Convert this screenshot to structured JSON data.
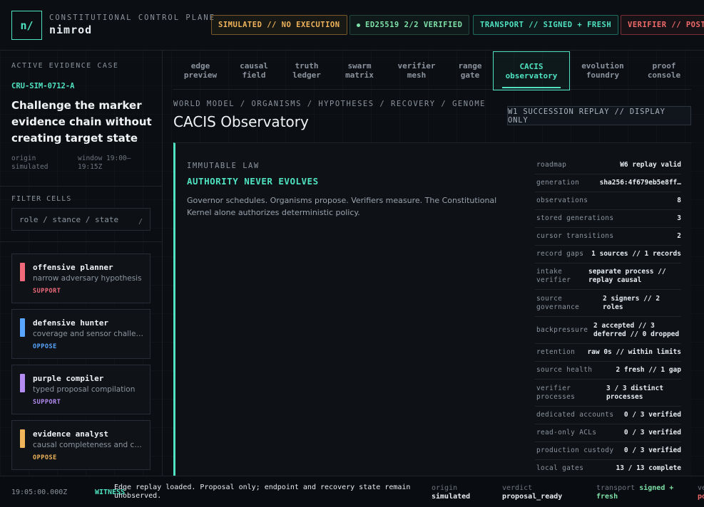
{
  "header": {
    "logo": "n/",
    "kicker": "CONSTITUTIONAL CONTROL PLANE",
    "app_name": "nimrod",
    "pills": {
      "simulated": "SIMULATED // NO EXECUTION",
      "ed25519": "ED25519 2/2 VERIFIED",
      "transport": "TRANSPORT // SIGNED + FRESH",
      "verifier": "VERIFIER // POST-"
    }
  },
  "sidebar": {
    "kicker": "ACTIVE EVIDENCE CASE",
    "case_id": "CRU-SIM-0712-A",
    "case_title": "Challenge the marker evidence chain without creating target state",
    "origin": "origin simulated",
    "window": "window 19:00–19:15Z",
    "filter_label": "FILTER CELLS",
    "filter_placeholder": "role / stance / state",
    "filter_slash": "/",
    "cards": [
      {
        "title": "offensive planner",
        "subtitle": "narrow adversary hypothesis",
        "stance": "SUPPORT",
        "color": "#f06a7a"
      },
      {
        "title": "defensive hunter",
        "subtitle": "coverage and sensor challenge",
        "stance": "OPPOSE",
        "color": "#58a6ff"
      },
      {
        "title": "purple compiler",
        "subtitle": "typed proposal compilation",
        "stance": "SUPPORT",
        "color": "#b48cf2"
      },
      {
        "title": "evidence analyst",
        "subtitle": "causal completeness and contradiction",
        "stance": "OPPOSE",
        "color": "#f0b45a"
      }
    ]
  },
  "tabs": [
    {
      "line1": "edge",
      "line2": "preview"
    },
    {
      "line1": "causal",
      "line2": "field"
    },
    {
      "line1": "truth",
      "line2": "ledger"
    },
    {
      "line1": "swarm",
      "line2": "matrix"
    },
    {
      "line1": "verifier",
      "line2": "mesh"
    },
    {
      "line1": "range",
      "line2": "gate"
    },
    {
      "line1": "CACIS",
      "line2": "observatory"
    },
    {
      "line1": "evolution",
      "line2": "foundry"
    },
    {
      "line1": "proof",
      "line2": "console"
    }
  ],
  "breadcrumb": "WORLD MODEL / ORGANISMS / HYPOTHESES / RECOVERY / GENOME",
  "page_title": "CACIS Observatory",
  "replay_label": "W1 SUCCESSION REPLAY // DISPLAY ONLY",
  "law": {
    "kicker": "IMMUTABLE LAW",
    "title": "AUTHORITY NEVER EVOLVES",
    "text": "Governor schedules. Organisms propose. Verifiers measure. The Constitutional Kernel alone authorizes deterministic policy."
  },
  "facts": [
    {
      "key": "roadmap",
      "value": "W6 replay valid"
    },
    {
      "key": "generation",
      "value": "sha256:4f679eb5e8ff…"
    },
    {
      "key": "observations",
      "value": "8"
    },
    {
      "key": "stored generations",
      "value": "3"
    },
    {
      "key": "cursor transitions",
      "value": "2"
    },
    {
      "key": "record gaps",
      "value": "1 sources // 1 records"
    },
    {
      "key": "intake verifier",
      "value": "separate process // replay causal"
    },
    {
      "key": "source governance",
      "value": "2 signers // 2 roles"
    },
    {
      "key": "backpressure",
      "value": "2 accepted // 3 deferred // 0 dropped"
    },
    {
      "key": "retention",
      "value": "raw 0s // within limits"
    },
    {
      "key": "source health",
      "value": "2 fresh // 1 gap"
    },
    {
      "key": "verifier processes",
      "value": "3 / 3 distinct processes"
    },
    {
      "key": "dedicated accounts",
      "value": "0 / 3 verified"
    },
    {
      "key": "read-only ACLs",
      "value": "0 / 3 verified"
    },
    {
      "key": "production custody",
      "value": "0 / 3 verified"
    },
    {
      "key": "local gates",
      "value": "13 / 13 complete"
    }
  ],
  "statusbar": {
    "time": "19:05:00.000Z",
    "witness": "WITNESS",
    "message": "Edge replay loaded. Proposal only; endpoint and recovery state remain unobserved.",
    "origin_label": "origin",
    "origin_value": "simulated",
    "verdict_label": "verdict",
    "verdict_value": "proposal_ready",
    "transport_label": "transport",
    "transport_value": "signed + fresh",
    "last_label": "ve",
    "last_value": "po"
  }
}
